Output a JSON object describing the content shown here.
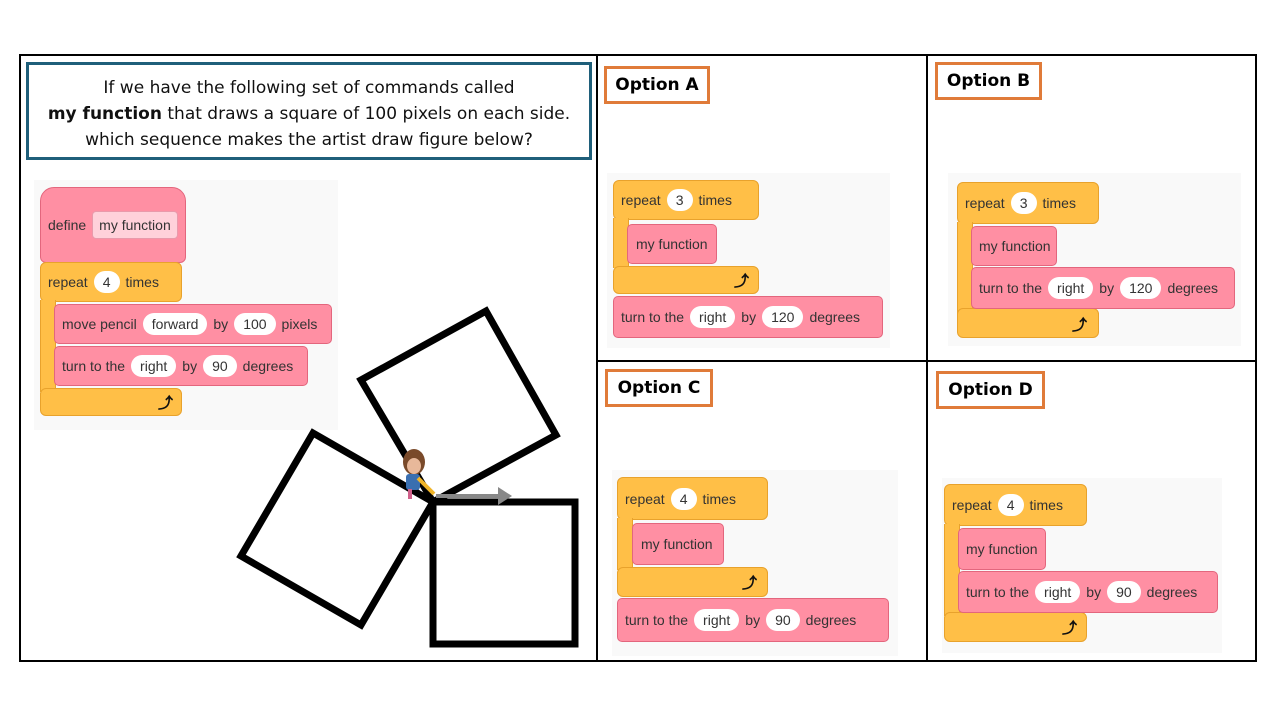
{
  "question": {
    "line1": "If we have the following set of commands called",
    "bold": "my function",
    "line2_rest": " that draws a square of 100 pixels on each side.",
    "line3": "which sequence makes the artist draw figure below?"
  },
  "definition": {
    "define": "define",
    "name": "my function",
    "repeat": "repeat",
    "count": "4",
    "times": "times",
    "move": "move pencil",
    "direction": "forward",
    "by": "by",
    "distance": "100",
    "pixels": "pixels",
    "turn": "turn to the",
    "turn_dir": "right",
    "angle": "90",
    "degrees": "degrees"
  },
  "options": [
    {
      "label": "Option A",
      "repeat": "repeat",
      "count": "3",
      "times": "times",
      "fn": "my function",
      "turn": "turn to the",
      "dir": "right",
      "by": "by",
      "angle": "120",
      "degrees": "degrees"
    },
    {
      "label": "Option B",
      "repeat": "repeat",
      "count": "3",
      "times": "times",
      "fn": "my function",
      "turn": "turn to the",
      "dir": "right",
      "by": "by",
      "angle": "120",
      "degrees": "degrees"
    },
    {
      "label": "Option C",
      "repeat": "repeat",
      "count": "4",
      "times": "times",
      "fn": "my function",
      "turn": "turn to the",
      "dir": "right",
      "by": "by",
      "angle": "90",
      "degrees": "degrees"
    },
    {
      "label": "Option D",
      "repeat": "repeat",
      "count": "4",
      "times": "times",
      "fn": "my function",
      "turn": "turn to the",
      "dir": "right",
      "by": "by",
      "angle": "90",
      "degrees": "degrees"
    }
  ],
  "icons": {
    "loop": "loop-arrow-icon",
    "artist": "artist-character-icon",
    "heading": "heading-arrow-icon"
  }
}
